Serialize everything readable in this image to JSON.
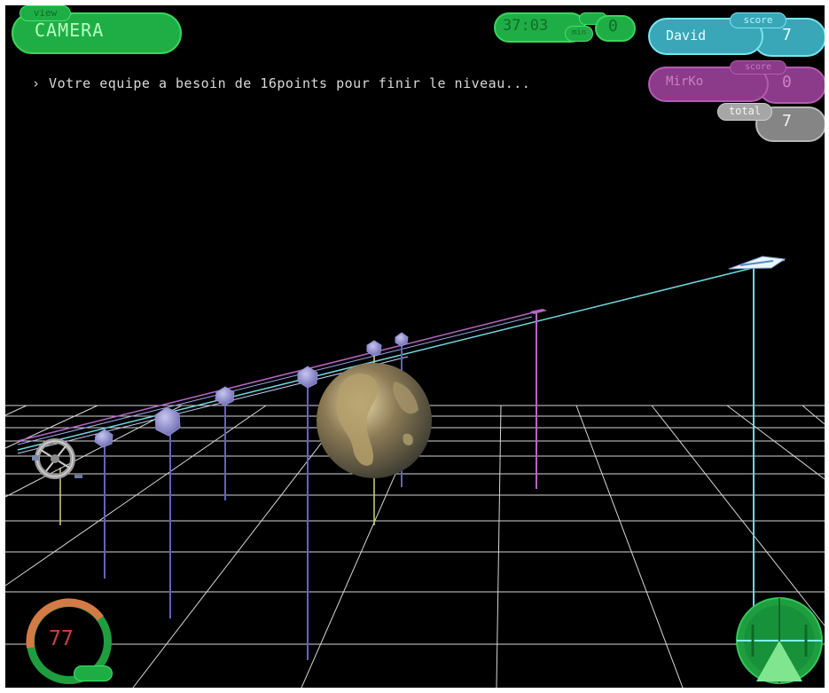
{
  "hud": {
    "view_tag": "view",
    "view_label": "CAMERA",
    "timer": "37:03",
    "timer_unit": "min",
    "team_score": "0",
    "status_message": "› Votre equipe a besoin de 16points pour finir le niveau..."
  },
  "players": [
    {
      "tag": "score",
      "name": "David",
      "score": "7",
      "color": "#3aa7b8"
    },
    {
      "tag": "score",
      "name": "MirKo",
      "score": "0",
      "color": "#8c3a8a"
    }
  ],
  "total": {
    "tag": "total",
    "value": "7"
  },
  "gauge": {
    "value": "77",
    "color": "#d13f3f",
    "level": 0.77
  },
  "icons": {
    "radar": "radar-icon",
    "planet": "earth-planet",
    "station": "space-station-icon",
    "ship": "spaceship-icon"
  }
}
